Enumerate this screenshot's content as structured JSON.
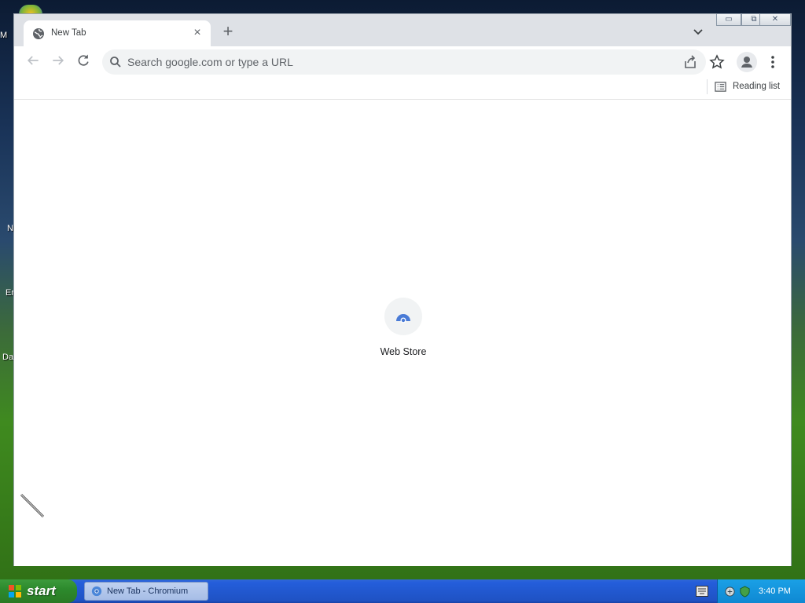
{
  "desktop": {
    "icons": [
      {
        "label": "M"
      },
      {
        "label": "N"
      },
      {
        "label": "Er"
      },
      {
        "label": "Da"
      }
    ]
  },
  "browser": {
    "tab": {
      "title": "New Tab",
      "favicon": "globe-icon"
    },
    "new_tab_symbol": "+",
    "window_controls": {
      "minimize": "▭",
      "restore": "⧉",
      "close": "✕"
    },
    "omnibox": {
      "placeholder": "Search google.com or type a URL",
      "value": ""
    },
    "bookmark_bar": {
      "reading_list_label": "Reading list"
    },
    "content": {
      "shortcuts": [
        {
          "label": "Web Store",
          "icon": "web-store-icon"
        }
      ]
    }
  },
  "taskbar": {
    "start_label": "start",
    "items": [
      {
        "label": "New Tab - Chromium",
        "icon": "chromium-icon"
      }
    ],
    "clock": "3:40 PM"
  }
}
